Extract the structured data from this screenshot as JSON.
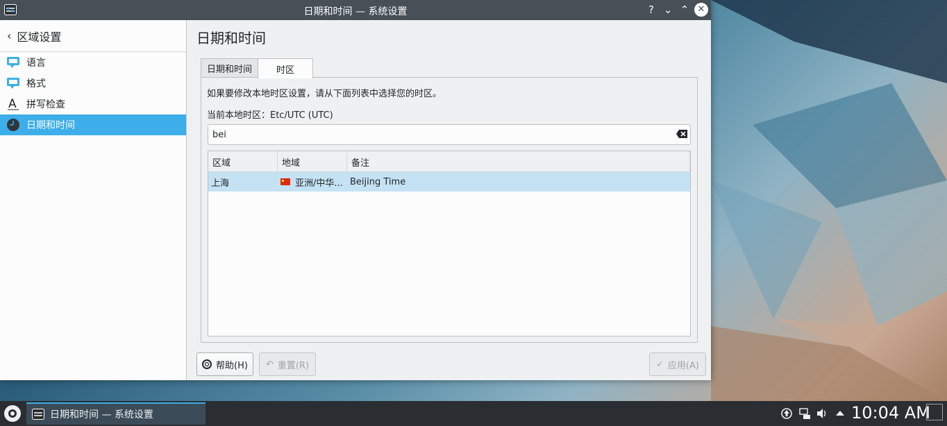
{
  "window": {
    "title": "日期和时间 — 系统设置",
    "help_glyph": "?",
    "minimize_glyph": "⌄",
    "maximize_glyph": "⌃",
    "close_glyph": "✕",
    "app_icon": "system-settings-icon"
  },
  "sidebar": {
    "header": "区域设置",
    "back_icon": "chevron-left-icon",
    "items": [
      {
        "label": "语言",
        "icon": "speech-bubble-icon"
      },
      {
        "label": "格式",
        "icon": "speech-bubble-icon"
      },
      {
        "label": "拼写检查",
        "icon": "letter-a-icon"
      },
      {
        "label": "日期和时间",
        "icon": "clock-icon",
        "active": true
      }
    ]
  },
  "main": {
    "title": "日期和时间",
    "tabs": [
      {
        "label": "日期和时间"
      },
      {
        "label": "时区",
        "active": true
      }
    ],
    "hint": "如果要修改本地时区设置，请从下面列表中选择您的时区。",
    "current_tz": "当前本地时区：Etc/UTC (UTC)",
    "search": {
      "value": "bei"
    },
    "table": {
      "columns": [
        "区域",
        "地域",
        "备注"
      ],
      "rows": [
        {
          "region": "上海",
          "area": "亚洲/中华...",
          "note": "Beijing Time",
          "selected": true
        }
      ]
    }
  },
  "buttons": {
    "help": "帮助(H)",
    "reset": "重置(R)",
    "apply": "应用(A)"
  },
  "taskbar": {
    "task_label": "日期和时间 — 系统设置",
    "clock": "10:04 AM"
  },
  "colors": {
    "accent": "#3daee9",
    "titlebar": "#475057",
    "selection": "#c5e2f5",
    "taskbar": "#2a2e32"
  }
}
